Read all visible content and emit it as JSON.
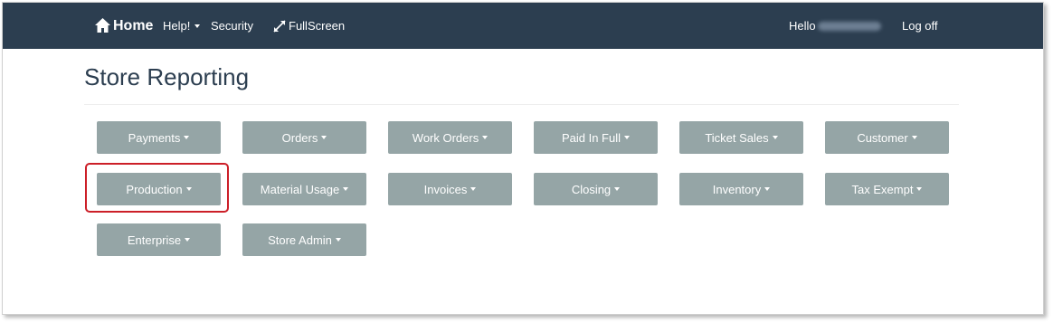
{
  "navbar": {
    "home_label": "Home",
    "help_label": "Help!",
    "security_label": "Security",
    "fullscreen_label": "FullScreen",
    "hello_label": "Hello",
    "logoff_label": "Log off",
    "background_color": "#2c3e50"
  },
  "page": {
    "title": "Store Reporting"
  },
  "report_buttons": [
    {
      "label": "Payments"
    },
    {
      "label": "Orders"
    },
    {
      "label": "Work Orders"
    },
    {
      "label": "Paid In Full"
    },
    {
      "label": "Ticket Sales"
    },
    {
      "label": "Customer"
    },
    {
      "label": "Production",
      "highlighted": true
    },
    {
      "label": "Material Usage"
    },
    {
      "label": "Invoices"
    },
    {
      "label": "Closing"
    },
    {
      "label": "Inventory"
    },
    {
      "label": "Tax Exempt"
    },
    {
      "label": "Enterprise"
    },
    {
      "label": "Store Admin"
    }
  ],
  "colors": {
    "button_bg": "#95a5a6",
    "highlight_border": "#cc1f28",
    "title": "#2c3e50"
  }
}
